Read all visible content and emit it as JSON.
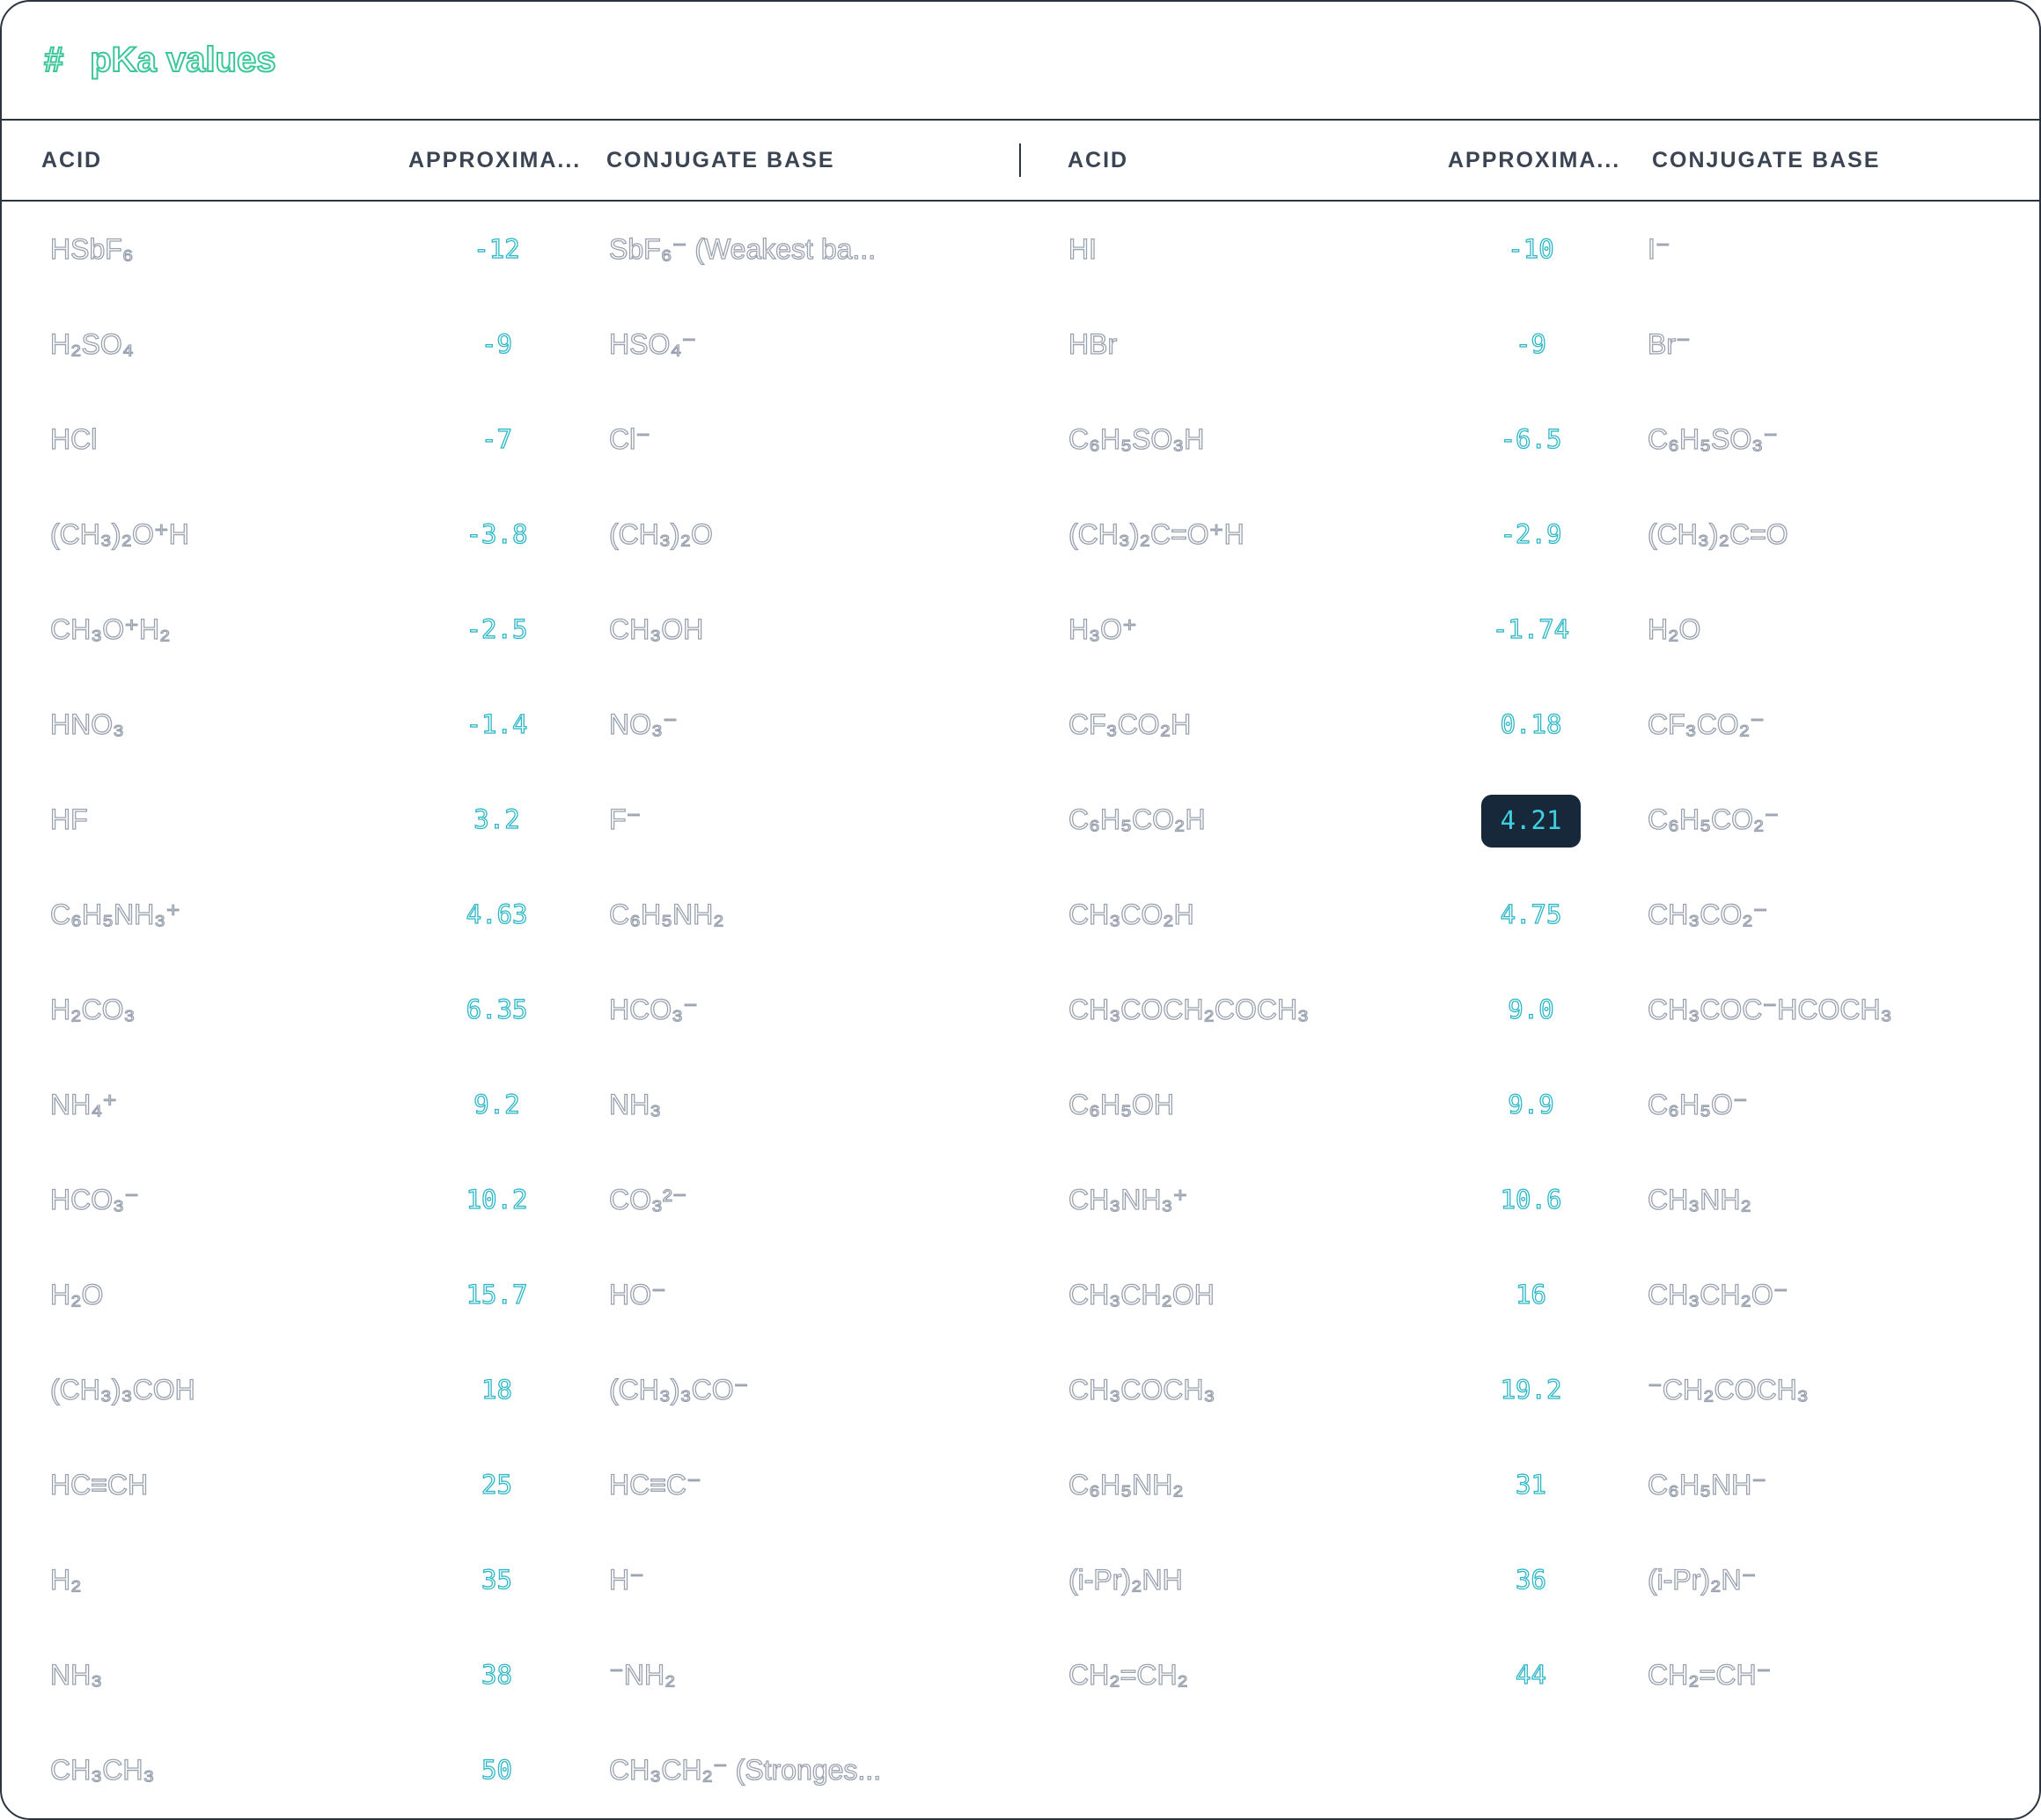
{
  "title": {
    "icon": "#",
    "text": "pKa values"
  },
  "headers": [
    "ACID",
    "APPROXIMA...",
    "CONJUGATE BASE",
    "ACID",
    "APPROXIMA...",
    "CONJUGATE BASE"
  ],
  "selected_value": "4.21",
  "rows": [
    {
      "acid1": "HSbF₆",
      "pka1": "-12",
      "base1": "SbF₆⁻ (Weakest ba...",
      "acid2": "HI",
      "pka2": "-10",
      "base2": "I⁻"
    },
    {
      "acid1": "H₂SO₄",
      "pka1": "-9",
      "base1": "HSO₄⁻",
      "acid2": "HBr",
      "pka2": "-9",
      "base2": "Br⁻"
    },
    {
      "acid1": "HCl",
      "pka1": "-7",
      "base1": "Cl⁻",
      "acid2": "C₆H₅SO₃H",
      "pka2": "-6.5",
      "base2": "C₆H₅SO₃⁻"
    },
    {
      "acid1": "(CH₃)₂O⁺H",
      "pka1": "-3.8",
      "base1": "(CH₃)₂O",
      "acid2": "(CH₃)₂C=O⁺H",
      "pka2": "-2.9",
      "base2": "(CH₃)₂C=O"
    },
    {
      "acid1": "CH₃O⁺H₂",
      "pka1": "-2.5",
      "base1": "CH₃OH",
      "acid2": "H₃O⁺",
      "pka2": "-1.74",
      "base2": "H₂O"
    },
    {
      "acid1": "HNO₃",
      "pka1": "-1.4",
      "base1": "NO₃⁻",
      "acid2": "CF₃CO₂H",
      "pka2": "0.18",
      "base2": "CF₃CO₂⁻"
    },
    {
      "acid1": "HF",
      "pka1": "3.2",
      "base1": "F⁻",
      "acid2": "C₆H₅CO₂H",
      "pka2": "4.21",
      "base2": "C₆H₅CO₂⁻"
    },
    {
      "acid1": "C₆H₅NH₃⁺",
      "pka1": "4.63",
      "base1": "C₆H₅NH₂",
      "acid2": "CH₃CO₂H",
      "pka2": "4.75",
      "base2": "CH₃CO₂⁻"
    },
    {
      "acid1": "H₂CO₃",
      "pka1": "6.35",
      "base1": "HCO₃⁻",
      "acid2": "CH₃COCH₂COCH₃",
      "pka2": "9.0",
      "base2": "CH₃COC⁻HCOCH₃"
    },
    {
      "acid1": "NH₄⁺",
      "pka1": "9.2",
      "base1": "NH₃",
      "acid2": "C₆H₅OH",
      "pka2": "9.9",
      "base2": "C₆H₅O⁻"
    },
    {
      "acid1": "HCO₃⁻",
      "pka1": "10.2",
      "base1": "CO₃²⁻",
      "acid2": "CH₃NH₃⁺",
      "pka2": "10.6",
      "base2": "CH₃NH₂"
    },
    {
      "acid1": "H₂O",
      "pka1": "15.7",
      "base1": "HO⁻",
      "acid2": "CH₃CH₂OH",
      "pka2": "16",
      "base2": "CH₃CH₂O⁻"
    },
    {
      "acid1": "(CH₃)₃COH",
      "pka1": "18",
      "base1": "(CH₃)₃CO⁻",
      "acid2": "CH₃COCH₃",
      "pka2": "19.2",
      "base2": "⁻CH₂COCH₃"
    },
    {
      "acid1": "HC≡CH",
      "pka1": "25",
      "base1": "HC≡C⁻",
      "acid2": "C₆H₅NH₂",
      "pka2": "31",
      "base2": "C₆H₅NH⁻"
    },
    {
      "acid1": "H₂",
      "pka1": "35",
      "base1": "H⁻",
      "acid2": "(i-Pr)₂NH",
      "pka2": "36",
      "base2": "(i-Pr)₂N⁻"
    },
    {
      "acid1": "NH₃",
      "pka1": "38",
      "base1": "⁻NH₂",
      "acid2": "CH₂=CH₂",
      "pka2": "44",
      "base2": "CH₂=CH⁻"
    },
    {
      "acid1": "CH₃CH₃",
      "pka1": "50",
      "base1": "CH₃CH₂⁻ (Stronges...",
      "acid2": "",
      "pka2": "",
      "base2": ""
    }
  ]
}
